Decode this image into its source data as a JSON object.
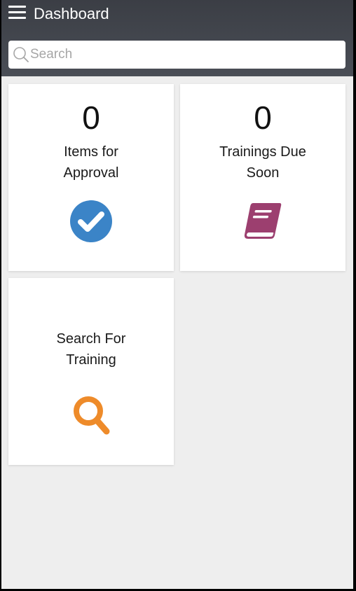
{
  "header": {
    "title": "Dashboard",
    "menu_icon": "hamburger-menu-icon"
  },
  "search": {
    "placeholder": "Search",
    "value": "",
    "icon": "search-icon"
  },
  "tiles": [
    {
      "count": "0",
      "label_line1": "Items for",
      "label_line2": "Approval",
      "icon": "check-circle-icon",
      "icon_color": "#3b84c7"
    },
    {
      "count": "0",
      "label_line1": "Trainings Due",
      "label_line2": "Soon",
      "icon": "book-icon",
      "icon_color": "#9c3f6f"
    },
    {
      "label_line1": "Search For",
      "label_line2": "Training",
      "icon": "magnifier-icon",
      "icon_color": "#ee8b2a"
    }
  ],
  "colors": {
    "header_bg": "#43464d",
    "page_bg": "#eeeeee"
  }
}
